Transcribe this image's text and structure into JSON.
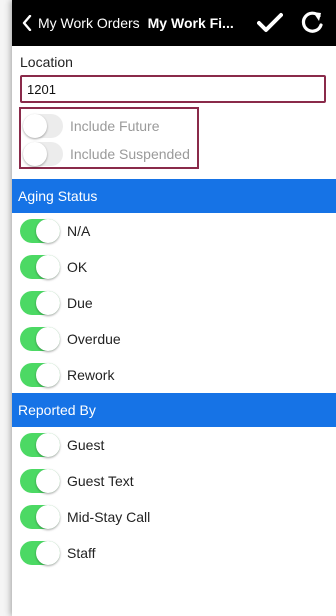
{
  "header": {
    "back_label": "My Work Orders",
    "title": "My Work Fi...",
    "confirm_icon": "checkmark-icon",
    "refresh_icon": "refresh-icon"
  },
  "location": {
    "label": "Location",
    "value": "1201"
  },
  "filters": [
    {
      "label": "Include Future",
      "on": false
    },
    {
      "label": "Include Suspended",
      "on": false
    }
  ],
  "aging_status": {
    "title": "Aging Status",
    "items": [
      {
        "label": "N/A",
        "on": true
      },
      {
        "label": "OK",
        "on": true
      },
      {
        "label": "Due",
        "on": true
      },
      {
        "label": "Overdue",
        "on": true
      },
      {
        "label": "Rework",
        "on": true
      }
    ]
  },
  "reported_by": {
    "title": "Reported By",
    "items": [
      {
        "label": "Guest",
        "on": true
      },
      {
        "label": "Guest Text",
        "on": true
      },
      {
        "label": "Mid-Stay Call",
        "on": true
      },
      {
        "label": "Staff",
        "on": true
      }
    ]
  },
  "colors": {
    "section_bg": "#1673e6",
    "toggle_on": "#4cd964",
    "highlight_border": "#8a2a4a"
  }
}
